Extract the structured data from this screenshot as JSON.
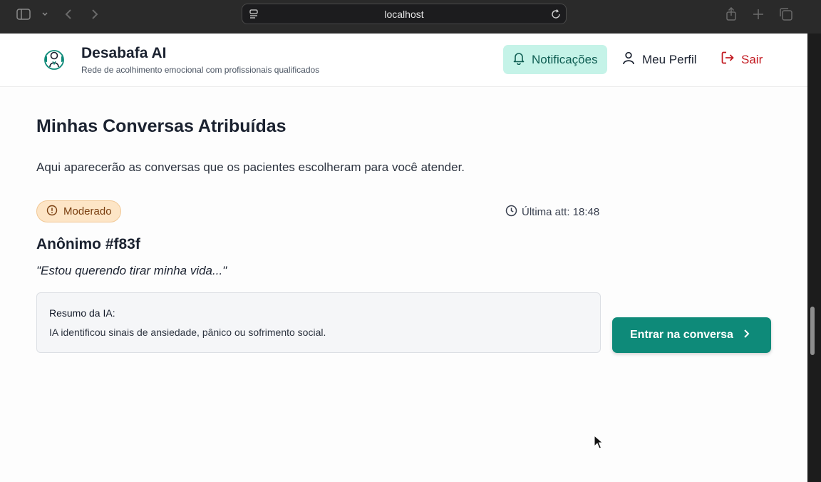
{
  "browser": {
    "url": "localhost"
  },
  "header": {
    "brand": "Desabafa AI",
    "tagline": "Rede de acolhimento emocional com profissionais qualificados",
    "nav": {
      "notifications": "Notificações",
      "profile": "Meu Perfil",
      "logout": "Sair"
    }
  },
  "main": {
    "title": "Minhas Conversas Atribuídas",
    "subtitle": "Aqui aparecerão as conversas que os pacientes escolheram para você atender."
  },
  "conversation": {
    "severity": "Moderado",
    "last_update": "Última att: 18:48",
    "patient": "Anônimo #f83f",
    "quote": "\"Estou querendo tirar minha vida...\"",
    "summary_label": "Resumo da IA:",
    "summary_text": "IA identificou sinais de ansiedade, pânico ou sofrimento social.",
    "enter_button": "Entrar na conversa"
  },
  "colors": {
    "accent": "#0e8a79",
    "notif_bg": "#c5f3e8",
    "logout": "#c2181f",
    "badge_bg": "#fde5c6"
  }
}
